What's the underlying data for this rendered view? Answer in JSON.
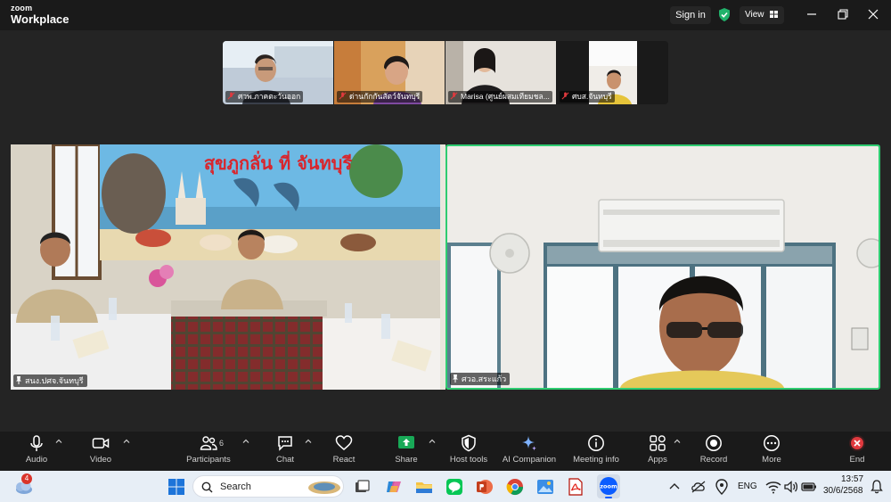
{
  "titlebar": {
    "brand": "zoom",
    "product": "Workplace",
    "signin_label": "Sign in",
    "view_label": "View"
  },
  "thumbnails": [
    {
      "name": "ศวพ.ภาคตะวันออก"
    },
    {
      "name": "ด่านกักกันสัตว์จันทบุรี"
    },
    {
      "name": "Marisa (ศูนย์ผสมเทียมชล..."
    },
    {
      "name": "ศบส.จันทบุรี"
    }
  ],
  "videos": [
    {
      "name": "สนง.ปศจ.จันทบุรี",
      "banner_text": "สุขภูกลั่น ที่ จันทบุรี"
    },
    {
      "name": "ศวอ.สระแก้ว"
    }
  ],
  "toolbar": {
    "audio": "Audio",
    "video": "Video",
    "participants": "Participants",
    "participants_count": "6",
    "chat": "Chat",
    "react": "React",
    "share": "Share",
    "host_tools": "Host tools",
    "ai_companion": "AI Companion",
    "meeting_info": "Meeting info",
    "apps": "Apps",
    "record": "Record",
    "more": "More",
    "end": "End"
  },
  "taskbar": {
    "weather_badge": "4",
    "search_placeholder": "Search",
    "language": "ENG",
    "time": "13:57",
    "date": "30/6/2568"
  },
  "colors": {
    "active_speaker": "#2ecc71",
    "share_green": "#18a957",
    "end_red": "#e0393e",
    "shield_green": "#21b26b"
  }
}
